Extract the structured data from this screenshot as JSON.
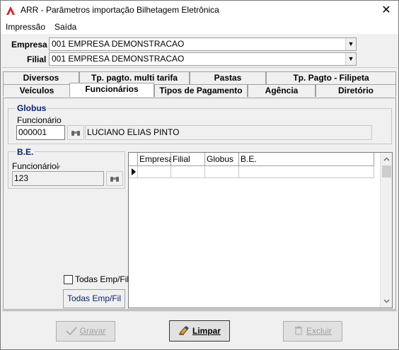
{
  "window": {
    "title": "ARR - Parâmetros importação Bilhetagem Eletrônica",
    "close_glyph": "✕"
  },
  "menu": [
    {
      "label": "Impressão"
    },
    {
      "label": "Saída"
    }
  ],
  "header": {
    "empresa_label": "Empresa",
    "empresa_value": "001 EMPRESA DEMONSTRACAO",
    "filial_label": "Filial",
    "filial_value": "001 EMPRESA DEMONSTRACAO"
  },
  "tabs_row1": [
    "Diversos",
    "Tp. pagto. multi tarifa",
    "Pastas",
    "Tp. Pagto - Filipeta"
  ],
  "tabs_row2": [
    "Veículos",
    "Funcionários",
    "Tipos de Pagamento",
    "Agência",
    "Diretório"
  ],
  "active_tab": "Funcionários",
  "globus": {
    "title": "Globus",
    "funcionario_label": "Funcionário",
    "funcionario_code": "000001",
    "funcionario_name": "LUCIANO ELIAS PINTO"
  },
  "be": {
    "title": "B.E.",
    "funcionario_label": "Funcionário",
    "funcionario_value": "123"
  },
  "grid": {
    "columns": [
      "Empresa",
      "Filial",
      "Globus",
      "B.E."
    ]
  },
  "todas_checkbox_label": "Todas Emp/Fil",
  "todas_button_label": "Todas Emp/Fil",
  "buttons": {
    "gravar": "Gravar",
    "limpar": "Limpar",
    "excluir": "Excluir"
  },
  "colors": {
    "accent": "#0a246a",
    "window_bg": "#f0f0f0"
  }
}
